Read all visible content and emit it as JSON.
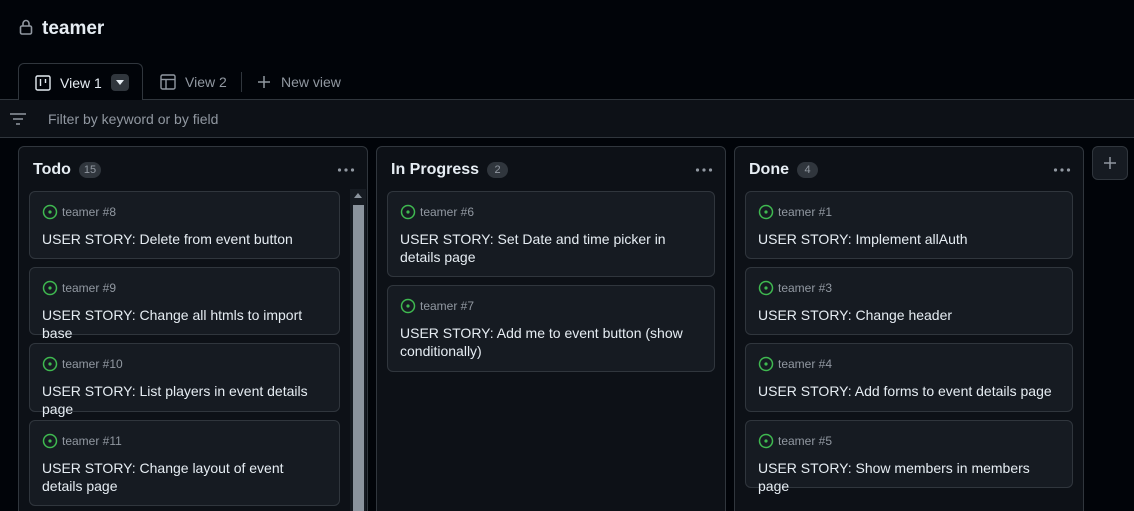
{
  "project": {
    "title": "teamer"
  },
  "tabs": [
    {
      "label": "View 1"
    },
    {
      "label": "View 2"
    },
    {
      "label": "New view"
    }
  ],
  "filter": {
    "placeholder": "Filter by keyword or by field"
  },
  "colors": {
    "accent_green": "#3fb950",
    "border": "#30363d",
    "muted": "#9198a1"
  },
  "columns": [
    {
      "title": "Todo",
      "count": "15",
      "cards": [
        {
          "ref": "teamer #8",
          "title": "USER STORY: Delete from event button"
        },
        {
          "ref": "teamer #9",
          "title": "USER STORY: Change all htmls to import base"
        },
        {
          "ref": "teamer #10",
          "title": "USER STORY: List players in event details page"
        },
        {
          "ref": "teamer #11",
          "title": "USER STORY: Change layout of event details page"
        }
      ]
    },
    {
      "title": "In Progress",
      "count": "2",
      "cards": [
        {
          "ref": "teamer #6",
          "title": "USER STORY: Set Date and time picker in details page"
        },
        {
          "ref": "teamer #7",
          "title": "USER STORY: Add me to event button (show conditionally)"
        }
      ]
    },
    {
      "title": "Done",
      "count": "4",
      "cards": [
        {
          "ref": "teamer #1",
          "title": "USER STORY: Implement allAuth"
        },
        {
          "ref": "teamer #3",
          "title": "USER STORY: Change header"
        },
        {
          "ref": "teamer #4",
          "title": "USER STORY: Add forms to event details page"
        },
        {
          "ref": "teamer #5",
          "title": "USER STORY: Show members in members page"
        }
      ]
    }
  ]
}
